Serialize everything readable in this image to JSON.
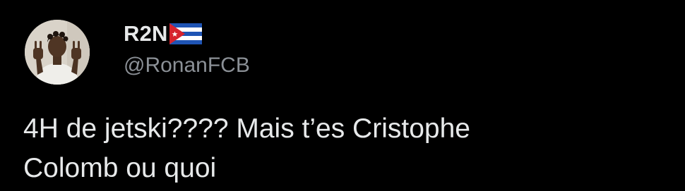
{
  "author": {
    "display_name": "R2N",
    "handle": "@RonanFCB",
    "flag_icon": "cuba-flag-icon",
    "avatar_icon": "profile-photo"
  },
  "tweet": {
    "text_line_1": "4H de jetski???? Mais t’es Cristophe",
    "text_line_2": "Colomb ou quoi"
  },
  "colors": {
    "background": "#000000",
    "primary_text": "#e7e9ea",
    "secondary_text": "#8b9096"
  }
}
